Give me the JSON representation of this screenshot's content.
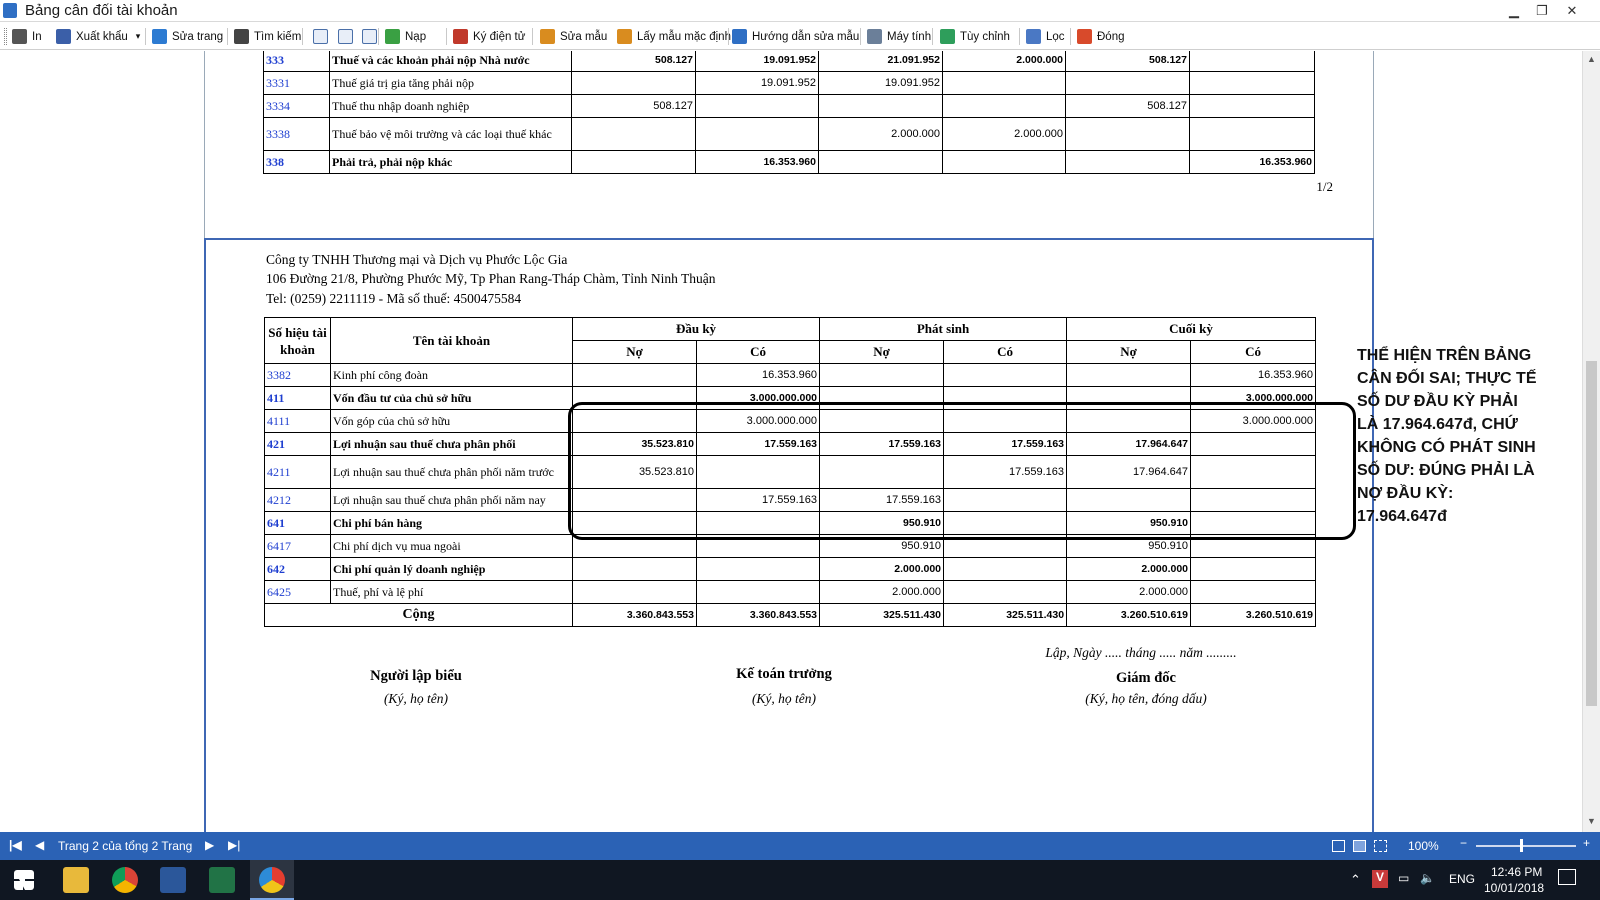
{
  "window": {
    "title": "Bảng cân đối tài khoản",
    "controls": [
      "▁",
      "❐",
      "✕"
    ]
  },
  "toolbar": {
    "items": [
      {
        "label": "In",
        "icon": "printer-icon",
        "color": "#555555"
      },
      {
        "label": "Xuất khẩu",
        "icon": "export-icon",
        "color": "#3b5fa8"
      },
      {
        "label": "Sửa trang",
        "icon": "edit-page-icon",
        "color": "#2d7bd2"
      },
      {
        "label": "Tìm kiếm",
        "icon": "binoculars-icon",
        "color": "#444444"
      },
      {
        "label": "Nạp",
        "icon": "reload-icon",
        "color": "#3aa043"
      },
      {
        "label": "Ký điện tử",
        "icon": "signature-icon",
        "color": "#c0392b"
      },
      {
        "label": "Sửa mẫu",
        "icon": "edit-template-icon",
        "color": "#d98c1f"
      },
      {
        "label": "Lấy mẫu mặc định",
        "icon": "default-template-icon",
        "color": "#d98c1f"
      },
      {
        "label": "Hướng dẫn sửa mẫu",
        "icon": "help-icon",
        "color": "#2f6fc4"
      },
      {
        "label": "Máy tính",
        "icon": "calculator-icon",
        "color": "#6b7f99"
      },
      {
        "label": "Tùy chỉnh",
        "icon": "customize-icon",
        "color": "#2e9e5b"
      },
      {
        "label": "Lọc",
        "icon": "filter-icon",
        "color": "#4a78c4"
      },
      {
        "label": "Đóng",
        "icon": "close-red-icon",
        "color": "#d84a2b"
      }
    ]
  },
  "page1": {
    "rows": [
      {
        "code": "333",
        "name": "Thuế và các khoản phải nộp Nhà nước",
        "bold": true,
        "v": [
          "",
          "508.127",
          "19.091.952",
          "21.091.952",
          "2.000.000",
          "508.127",
          ""
        ]
      },
      {
        "code": "3331",
        "name": "Thuế giá trị gia tăng phải nộp",
        "bold": false,
        "v": [
          "",
          "",
          "19.091.952",
          "19.091.952",
          "",
          "",
          ""
        ]
      },
      {
        "code": "3334",
        "name": "Thuế thu nhập doanh nghiệp",
        "bold": false,
        "v": [
          "",
          "508.127",
          "",
          "",
          "",
          "508.127",
          ""
        ]
      },
      {
        "code": "3338",
        "name": "Thuế bảo vệ môi trường và các loại thuế khác",
        "bold": false,
        "v": [
          "",
          "",
          "",
          "2.000.000",
          "2.000.000",
          "",
          ""
        ]
      },
      {
        "code": "338",
        "name": "Phải trả, phải nộp khác",
        "bold": true,
        "v": [
          "",
          "",
          "16.353.960",
          "",
          "",
          "",
          "16.353.960"
        ]
      }
    ],
    "page_number": "1/2"
  },
  "page2": {
    "company_name": "Công ty TNHH Thương mại và Dịch vụ Phước Lộc Gia",
    "company_address": "106 Đường 21/8, Phường Phước Mỹ, Tp Phan Rang-Tháp Chàm, Tỉnh Ninh Thuận",
    "company_tel": "Tel: (0259) 2211119 - Mã số thuế: 4500475584",
    "headers": {
      "code": "Số hiệu tài khoản",
      "name": "Tên tài khoản",
      "opening": "Đầu kỳ",
      "period": "Phát sinh",
      "closing": "Cuối kỳ",
      "debit": "Nợ",
      "credit": "Có"
    },
    "rows": [
      {
        "code": "3382",
        "name": "Kinh phí công đoàn",
        "bold": false,
        "v": [
          "",
          "16.353.960",
          "",
          "",
          "",
          "16.353.960"
        ]
      },
      {
        "code": "411",
        "name": "Vốn đầu tư của chủ sở hữu",
        "bold": true,
        "v": [
          "",
          "3.000.000.000",
          "",
          "",
          "",
          "3.000.000.000"
        ]
      },
      {
        "code": "4111",
        "name": "Vốn góp của chủ sở hữu",
        "bold": false,
        "v": [
          "",
          "3.000.000.000",
          "",
          "",
          "",
          "3.000.000.000"
        ]
      },
      {
        "code": "421",
        "name": "Lợi nhuận sau thuế chưa phân phối",
        "bold": true,
        "v": [
          "35.523.810",
          "17.559.163",
          "17.559.163",
          "17.559.163",
          "17.964.647",
          ""
        ]
      },
      {
        "code": "4211",
        "name": "Lợi nhuận sau thuế chưa phân phối năm trước",
        "bold": false,
        "v": [
          "35.523.810",
          "",
          "",
          "17.559.163",
          "17.964.647",
          ""
        ]
      },
      {
        "code": "4212",
        "name": "Lợi nhuận sau thuế chưa phân phối năm nay",
        "bold": false,
        "v": [
          "",
          "17.559.163",
          "17.559.163",
          "",
          "",
          ""
        ]
      },
      {
        "code": "641",
        "name": "Chi phí bán hàng",
        "bold": true,
        "v": [
          "",
          "",
          "950.910",
          "",
          "950.910",
          ""
        ]
      },
      {
        "code": "6417",
        "name": "Chi phí dịch vụ mua ngoài",
        "bold": false,
        "v": [
          "",
          "",
          "950.910",
          "",
          "950.910",
          ""
        ]
      },
      {
        "code": "642",
        "name": "Chi phí quản lý doanh nghiệp",
        "bold": true,
        "v": [
          "",
          "",
          "2.000.000",
          "",
          "2.000.000",
          ""
        ]
      },
      {
        "code": "6425",
        "name": "Thuế, phí và lệ phí",
        "bold": false,
        "v": [
          "",
          "",
          "2.000.000",
          "",
          "2.000.000",
          ""
        ]
      }
    ],
    "total": {
      "label": "Cộng",
      "v": [
        "3.360.843.553",
        "3.360.843.553",
        "325.511.430",
        "325.511.430",
        "3.260.510.619",
        "3.260.510.619"
      ]
    },
    "date_line": "Lập, Ngày ..... tháng ..... năm .........",
    "signatures": [
      {
        "title": "Người lập biểu",
        "note": "(Ký, họ tên)"
      },
      {
        "title": "Kế toán trưởng",
        "note": "(Ký, họ tên)"
      },
      {
        "title": "Giám đốc",
        "note": "(Ký, họ tên, đóng dấu)"
      }
    ]
  },
  "annotation": {
    "text": "THỂ HIỆN TRÊN BẢNG CÂN ĐỐI SAI; THỰC TẾ SỐ DƯ ĐẦU KỲ PHẢI LÀ 17.964.647đ, CHỨ KHÔNG CÓ PHÁT SINH SỐ DƯ: ĐÚNG PHẢI LÀ NỢ ĐẦU KỲ: 17.964.647đ"
  },
  "statusbar": {
    "page_info": "Trang 2 của tổng 2 Trang",
    "zoom": "100%",
    "color": "#2b62b5"
  },
  "taskbar": {
    "language": "ENG",
    "time": "12:46 PM",
    "date": "10/01/2018"
  }
}
